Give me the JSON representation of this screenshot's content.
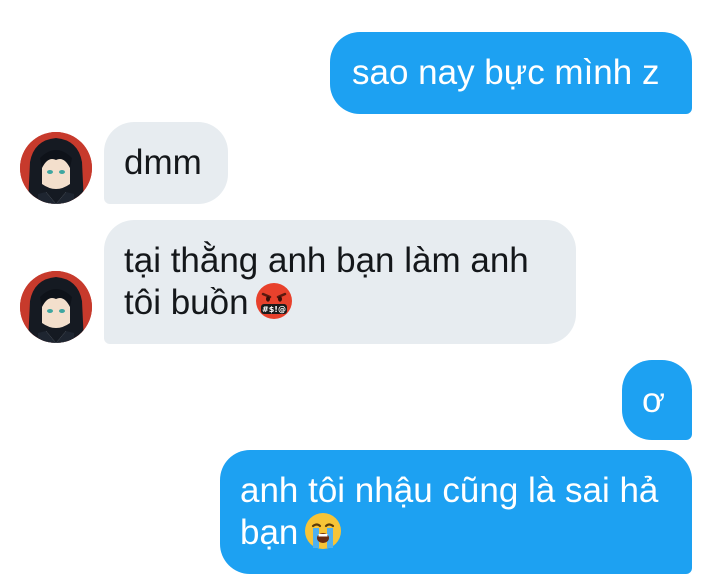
{
  "messages": [
    {
      "side": "out",
      "text": "sao nay bực mình z",
      "emoji": null
    },
    {
      "side": "in",
      "text": "dmm",
      "emoji": null
    },
    {
      "side": "in",
      "text_line1": "tại thằng anh bạn làm anh",
      "text_line2": "tôi buồn",
      "emoji": "face-with-symbols-on-mouth"
    },
    {
      "side": "out",
      "text": "ơ",
      "emoji": null
    },
    {
      "side": "out",
      "text_line1": "anh tôi nhậu cũng là sai hả",
      "text_line2": "bạn",
      "emoji": "loudly-crying-face"
    }
  ],
  "colors": {
    "outgoing_bubble": "#1da1f2",
    "incoming_bubble": "#e7ecf0",
    "avatar_bg": "#c73a2c"
  }
}
